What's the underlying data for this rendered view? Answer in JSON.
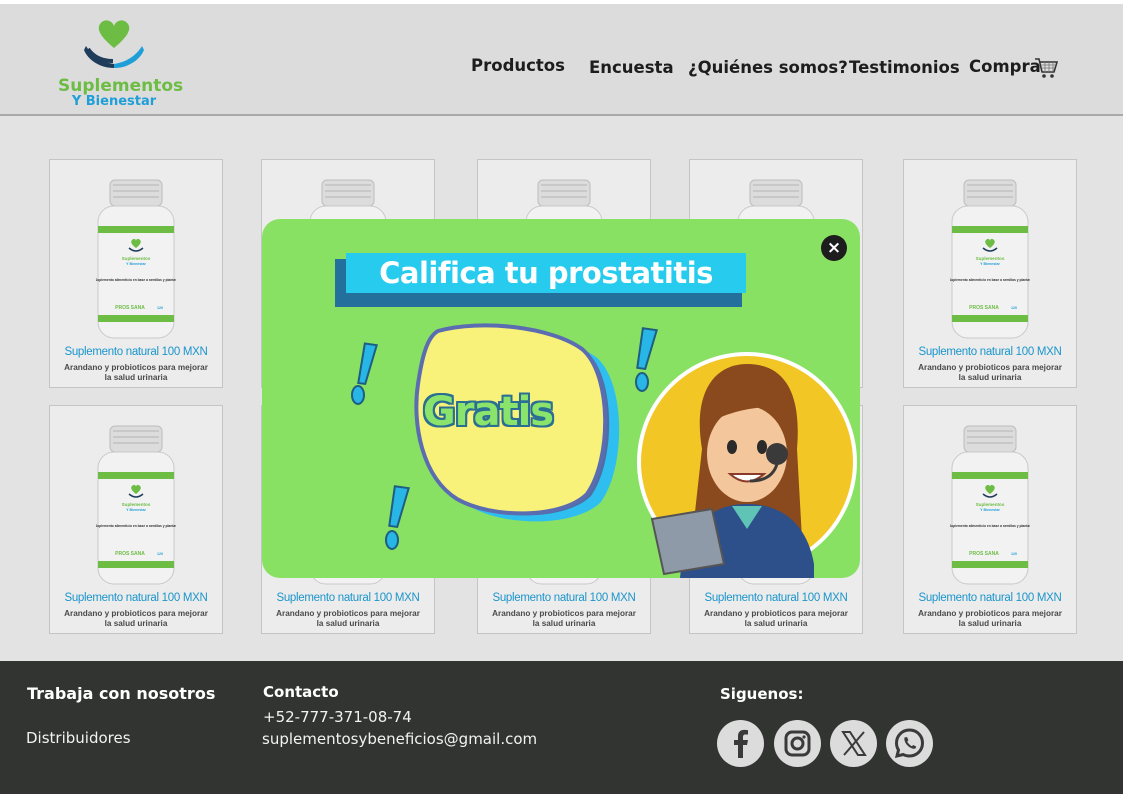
{
  "brand": {
    "line1": "Suplementos",
    "line2": "Y Bienestar"
  },
  "nav": {
    "productos": "Productos",
    "encuesta": "Encuesta",
    "quienes": "¿Quiénes somos?",
    "testimonios": "Testimonios",
    "compra": "Compra"
  },
  "product": {
    "title": "Suplemento natural 100 MXN",
    "desc": "Arandano y probioticos para mejorar la salud urinaria",
    "label_brand1": "Suplementos",
    "label_brand2": "Y Bienestar",
    "label_text": "Suplemento alimenticio en base a semillas y plantas",
    "label_name": "PROS SANA",
    "label_count": "120"
  },
  "modal": {
    "close": "×",
    "title": "Califica tu prostatitis",
    "badge": "Gratis"
  },
  "footer": {
    "work_heading": "Trabaja con nosotros",
    "work_link": "Distribuidores",
    "contact_heading": "Contacto",
    "phone": "+52-777-371-08-74",
    "email": "suplementosybeneficios@gmail.com",
    "social_heading": "Siguenos:"
  },
  "colors": {
    "brand_green": "#6dbd45",
    "brand_blue": "#1f9fd8",
    "modal_bg": "#89e164",
    "modal_title_band": "#27cbee",
    "footer_bg": "#323432"
  },
  "icons": [
    "heart-hands-logo-icon",
    "cart-icon",
    "close-icon",
    "facebook-icon",
    "instagram-icon",
    "x-icon",
    "whatsapp-icon"
  ]
}
